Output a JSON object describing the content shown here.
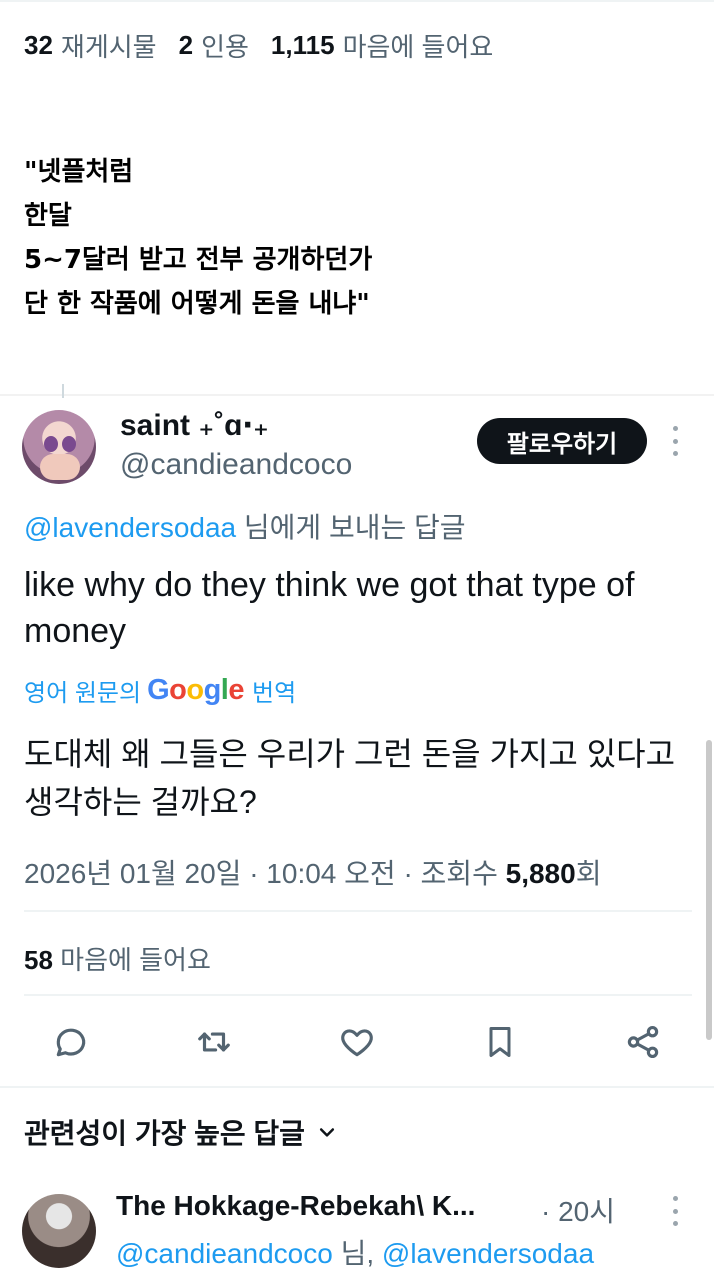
{
  "tweet_stats": {
    "retweets_count": "32",
    "retweets_label": "재게시물",
    "quotes_count": "2",
    "quotes_label": "인용",
    "likes_count": "1,115",
    "likes_label": "마음에 들어요"
  },
  "quoted_text": "\"넷플처럼\n한달\n5~7달러 받고 전부 공개하던가\n단 한 작품에 어떻게 돈을 내냐\"",
  "reply_tweet": {
    "author_name": "saint ₊˚ɑ‧₊",
    "author_handle": "@candieandcoco",
    "follow_label": "팔로우하기",
    "reply_to_handle": "@lavendersodaa",
    "reply_to_suffix": " 님에게 보내는 답글",
    "text": "like why do they think we got that type of money",
    "translate_prefix": "영어 원문의",
    "translate_suffix": "번역",
    "translated_text": "도대체 왜 그들은 우리가 그런 돈을 가지고 있다고 생각하는 걸까요?",
    "timestamp": "2026년 01월 20일 · 10:04 오전 · 조회수 ",
    "views_count": "5,880",
    "views_suffix": "회",
    "likes_count": "58",
    "likes_label": "마음에 들어요"
  },
  "icons": [
    "reply-icon",
    "retweet-icon",
    "like-icon",
    "bookmark-icon",
    "share-icon",
    "more-icon",
    "chevron-down-icon"
  ],
  "sort_label": "관련성이 가장 높은 답글",
  "next_reply": {
    "author_name": "The Hokkage-Rebekah\\ K...",
    "time": "· 20시",
    "handle_1": "@candieandcoco",
    "middle": " 님, ",
    "handle_2": "@lavendersodaa"
  },
  "colors": {
    "accent_blue": "#1d9bf0",
    "text_primary": "#0f1419",
    "text_secondary": "#536471",
    "follow_button_bg": "#0f1419"
  }
}
